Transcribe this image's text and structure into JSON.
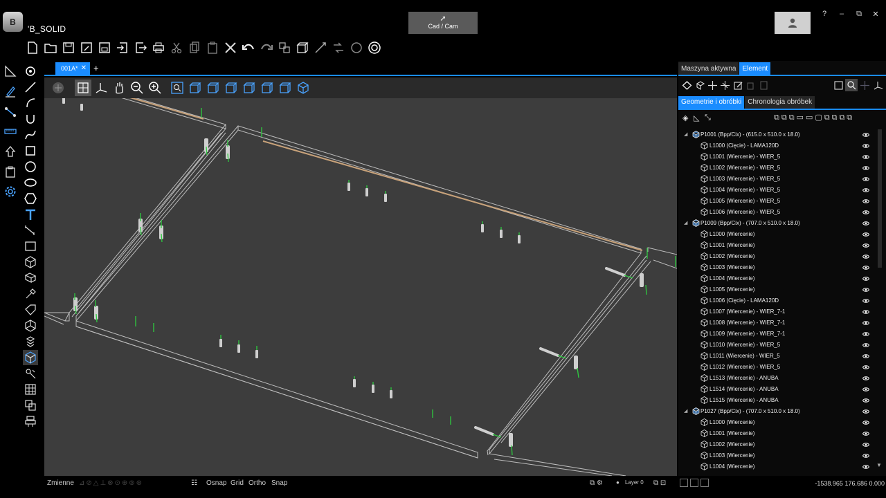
{
  "app": {
    "logo_text": "B",
    "title": "'B_SOLID",
    "mode_button": "Cad / Cam"
  },
  "window_controls": [
    "?",
    "–",
    "⧉",
    "✕"
  ],
  "document_tabs": [
    {
      "label": "001A*",
      "close": "✕"
    }
  ],
  "add_tab": "+",
  "panel": {
    "tabs": [
      "Maszyna aktywna",
      "Element"
    ],
    "active_tab": "Element",
    "subtabs": [
      "Geometrie i obróbki",
      "Chronologia obróbek"
    ],
    "active_subtab": "Geometrie i obróbki",
    "tree": [
      {
        "level": 0,
        "label": "P1001 (Bpp/Cix) - (615.0 x 510.0 x 18.0)"
      },
      {
        "level": 1,
        "label": "L1000 (Cięcie) - LAMA120D"
      },
      {
        "level": 1,
        "label": "L1001 (Wiercenie) - WIER_5"
      },
      {
        "level": 1,
        "label": "L1002 (Wiercenie) - WIER_5"
      },
      {
        "level": 1,
        "label": "L1003 (Wiercenie) - WIER_5"
      },
      {
        "level": 1,
        "label": "L1004 (Wiercenie) - WIER_5"
      },
      {
        "level": 1,
        "label": "L1005 (Wiercenie) - WIER_5"
      },
      {
        "level": 1,
        "label": "L1006 (Wiercenie) - WIER_5"
      },
      {
        "level": 0,
        "label": "P1009 (Bpp/Cix) - (707.0 x 510.0 x 18.0)"
      },
      {
        "level": 1,
        "label": "L1000 (Wiercenie)"
      },
      {
        "level": 1,
        "label": "L1001 (Wiercenie)"
      },
      {
        "level": 1,
        "label": "L1002 (Wiercenie)"
      },
      {
        "level": 1,
        "label": "L1003 (Wiercenie)"
      },
      {
        "level": 1,
        "label": "L1004 (Wiercenie)"
      },
      {
        "level": 1,
        "label": "L1005 (Wiercenie)"
      },
      {
        "level": 1,
        "label": "L1006 (Cięcie) - LAMA120D"
      },
      {
        "level": 1,
        "label": "L1007 (Wiercenie) - WIER_7-1"
      },
      {
        "level": 1,
        "label": "L1008 (Wiercenie) - WIER_7-1"
      },
      {
        "level": 1,
        "label": "L1009 (Wiercenie) - WIER_7-1"
      },
      {
        "level": 1,
        "label": "L1010 (Wiercenie) - WIER_5"
      },
      {
        "level": 1,
        "label": "L1011 (Wiercenie) - WIER_5"
      },
      {
        "level": 1,
        "label": "L1012 (Wiercenie) - WIER_5"
      },
      {
        "level": 1,
        "label": "L1513 (Wiercenie) - ANUBA"
      },
      {
        "level": 1,
        "label": "L1514 (Wiercenie) - ANUBA"
      },
      {
        "level": 1,
        "label": "L1515 (Wiercenie) - ANUBA"
      },
      {
        "level": 0,
        "label": "P1027 (Bpp/Cix) - (707.0 x 510.0 x 18.0)"
      },
      {
        "level": 1,
        "label": "L1000 (Wiercenie)"
      },
      {
        "level": 1,
        "label": "L1001 (Wiercenie)"
      },
      {
        "level": 1,
        "label": "L1002 (Wiercenie)"
      },
      {
        "level": 1,
        "label": "L1003 (Wiercenie)"
      },
      {
        "level": 1,
        "label": "L1004 (Wiercenie)"
      }
    ]
  },
  "status": {
    "variables": "Zmienne",
    "osnap": "Osnap",
    "grid": "Grid",
    "ortho": "Ortho",
    "snap": "Snap",
    "layer": "Layer 0",
    "coords": "-1538.965  176.686  0.000"
  },
  "colors": {
    "accent": "#1a8cff",
    "viewport_bg": "#3d3d3d",
    "edge": "#c8c8c8",
    "saw_cut": "#c8a27a",
    "drill_axis": "#2ecc40"
  }
}
